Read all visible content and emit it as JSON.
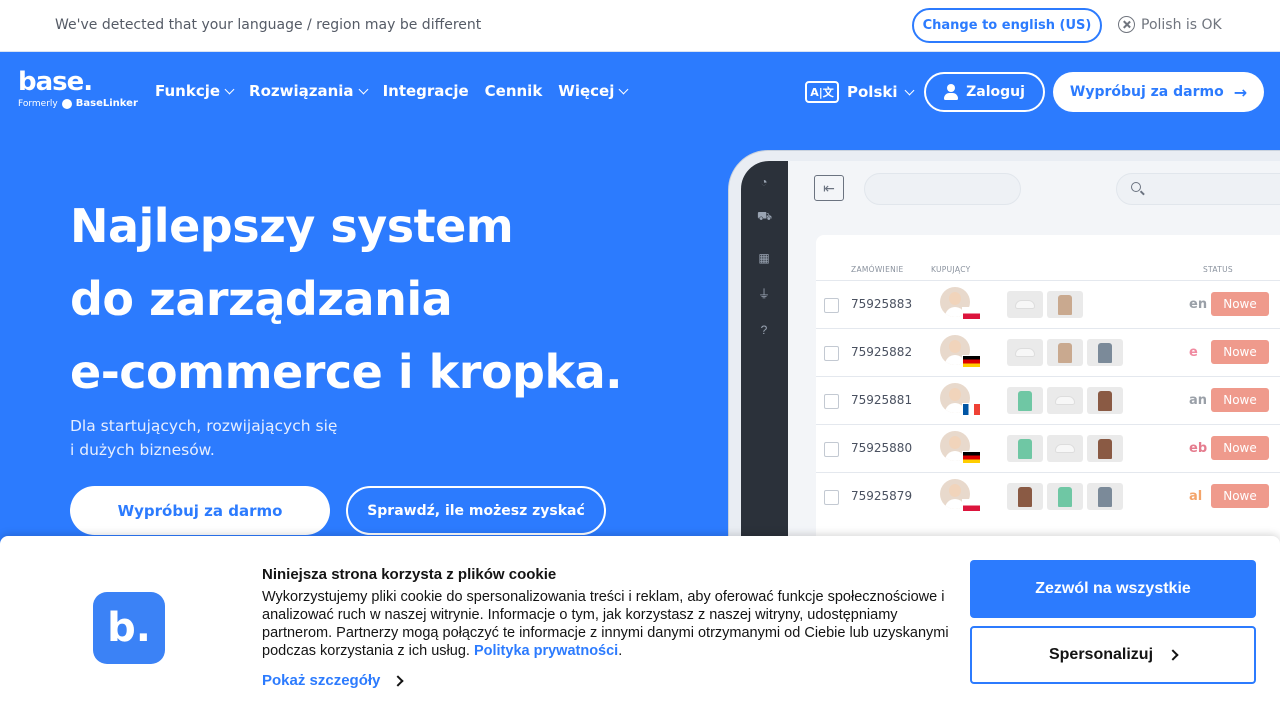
{
  "langbar": {
    "message": "We've detected that your language / region may be different",
    "change_button": "Change to english (US)",
    "dismiss_label": "Polish is OK"
  },
  "nav": {
    "logo_text": "base.",
    "logo_formerly": "Formerly",
    "logo_formerly_brand": "BaseLinker",
    "items": [
      {
        "label": "Funkcje",
        "has_dropdown": true
      },
      {
        "label": "Rozwiązania",
        "has_dropdown": true
      },
      {
        "label": "Integracje",
        "has_dropdown": false
      },
      {
        "label": "Cennik",
        "has_dropdown": false
      },
      {
        "label": "Więcej",
        "has_dropdown": true
      }
    ],
    "language": "Polski",
    "translate_icon_text": "A|文",
    "login_label": "Zaloguj",
    "try_label": "Wypróbuj za darmo"
  },
  "hero": {
    "title_lines": [
      "Najlepszy system",
      "do zarządzania",
      "e-commerce i kropka."
    ],
    "subtitle_lines": [
      "Dla startujących, rozwijających się",
      "i dużych biznesów."
    ],
    "primary_button": "Wypróbuj za darmo",
    "secondary_button": "Sprawdź, ile możesz zyskać"
  },
  "mockup": {
    "headers": {
      "order": "ZAMÓWIENIE",
      "buyer": "KUPUJĄCY",
      "status": "STATUS"
    },
    "rows": [
      {
        "order": "75925883",
        "flag": "pl",
        "products": [
          "shoe",
          "tan"
        ],
        "marketplace": "en",
        "marketplace_color": "#9aa0a8",
        "status": "Nowe"
      },
      {
        "order": "75925882",
        "flag": "de",
        "products": [
          "shoe",
          "tan",
          "gray"
        ],
        "marketplace": "e",
        "marketplace_color": "#f08aa0",
        "status": "Nowe"
      },
      {
        "order": "75925881",
        "flag": "fr",
        "products": [
          "green",
          "shoe",
          "brown"
        ],
        "marketplace": "an",
        "marketplace_color": "#9aa0a8",
        "status": "Nowe"
      },
      {
        "order": "75925880",
        "flag": "de",
        "products": [
          "green",
          "shoe",
          "brown"
        ],
        "marketplace": "eb",
        "marketplace_color": "#e57c8e",
        "status": "Nowe"
      },
      {
        "order": "75925879",
        "flag": "pl",
        "products": [
          "brown",
          "green",
          "gray"
        ],
        "marketplace": "al",
        "marketplace_color": "#f4a46a",
        "status": "Nowe"
      }
    ],
    "colors": {
      "status_bg": "#ef9a8c",
      "green": "#6fc7a4",
      "tan": "#c9a98f",
      "gray": "#7b8a99",
      "brown": "#8a5a44"
    }
  },
  "cookie": {
    "title": "Niniejsza strona korzysta z plików cookie",
    "body": "Wykorzystujemy pliki cookie do spersonalizowania treści i reklam, aby oferować funkcje społecznościowe i analizować ruch w naszej witrynie. Informacje o tym, jak korzystasz z naszej witryny, udostępniamy partnerom. Partnerzy mogą połączyć te informacje z innymi danymi otrzymanymi od Ciebie lub uzyskanymi podczas korzystania z ich usług.",
    "privacy_link": "Polityka prywatności",
    "period": ".",
    "details_link": "Pokaż szczegóły",
    "allow_all": "Zezwól na wszystkie",
    "customize": "Spersonalizuj",
    "logo_letter": "b."
  },
  "colors": {
    "brand_blue": "#2c7bfe",
    "banner_bg": "#ffffff"
  }
}
